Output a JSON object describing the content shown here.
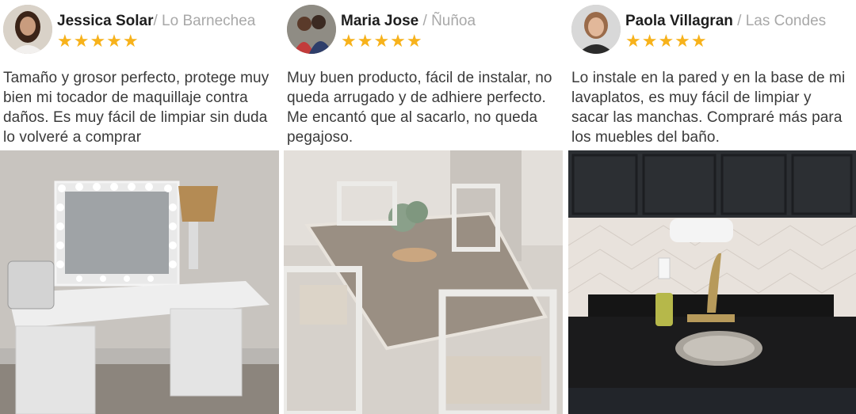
{
  "reviews": [
    {
      "name": "Jessica Solar",
      "location": "/ Lo Barnechea",
      "stars": "★★★★★",
      "text": "Tamaño y grosor perfecto, protege muy bien mi tocador de maquillaje contra daños. Es muy fácil de limpiar sin duda lo volveré a comprar"
    },
    {
      "name": "Maria Jose",
      "location": "/ Ñuñoa",
      "stars": "★★★★★",
      "text": "Muy buen producto, fácil de instalar, no queda arrugado y de adhiere perfecto. Me encantó que al sacarlo, no queda pegajoso."
    },
    {
      "name": "Paola Villagran",
      "location": "/ Las Condes",
      "stars": "★★★★★",
      "text": "Lo instale en la pared y en la base de mi lavaplatos, es muy fácil de limpiar y sacar las manchas. Compraré más para los muebles del baño."
    }
  ]
}
